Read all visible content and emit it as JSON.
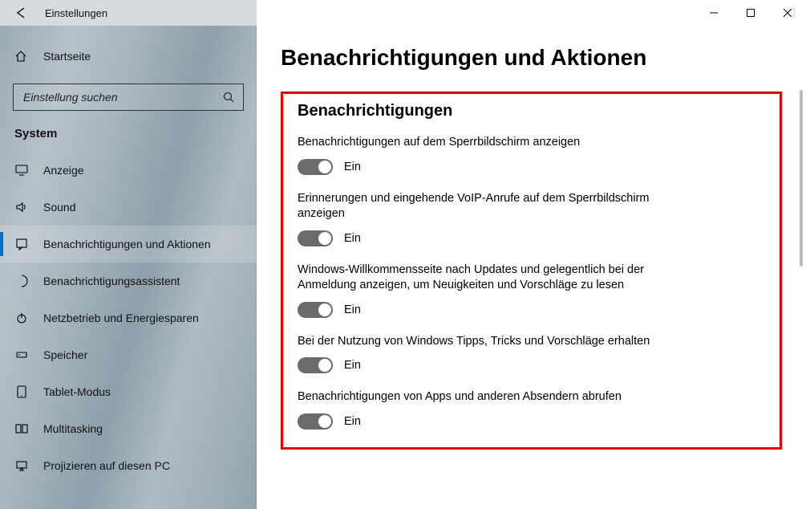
{
  "window": {
    "title": "Einstellungen"
  },
  "sidebar": {
    "home": "Startseite",
    "search_placeholder": "Einstellung suchen",
    "section": "System",
    "items": [
      {
        "label": "Anzeige",
        "icon": "display-icon",
        "active": false
      },
      {
        "label": "Sound",
        "icon": "sound-icon",
        "active": false
      },
      {
        "label": "Benachrichtigungen und Aktionen",
        "icon": "notifications-icon",
        "active": true
      },
      {
        "label": "Benachrichtigungsassistent",
        "icon": "focus-assist-icon",
        "active": false
      },
      {
        "label": "Netzbetrieb und Energiesparen",
        "icon": "power-icon",
        "active": false
      },
      {
        "label": "Speicher",
        "icon": "storage-icon",
        "active": false
      },
      {
        "label": "Tablet-Modus",
        "icon": "tablet-icon",
        "active": false
      },
      {
        "label": "Multitasking",
        "icon": "multitasking-icon",
        "active": false
      },
      {
        "label": "Projizieren auf diesen PC",
        "icon": "project-icon",
        "active": false
      }
    ]
  },
  "page": {
    "title": "Benachrichtigungen und Aktionen",
    "subheading": "Benachrichtigungen",
    "on_label": "Ein",
    "settings": [
      {
        "desc": "Benachrichtigungen auf dem Sperrbildschirm anzeigen",
        "state": "Ein"
      },
      {
        "desc": "Erinnerungen und eingehende VoIP-Anrufe auf dem Sperrbildschirm anzeigen",
        "state": "Ein"
      },
      {
        "desc": "Windows-Willkommensseite nach Updates und gelegentlich bei der Anmeldung anzeigen, um Neuigkeiten und Vorschläge zu lesen",
        "state": "Ein"
      },
      {
        "desc": "Bei der Nutzung von Windows Tipps, Tricks und Vorschläge erhalten",
        "state": "Ein"
      },
      {
        "desc": "Benachrichtigungen von Apps und anderen Absendern abrufen",
        "state": "Ein"
      }
    ]
  }
}
